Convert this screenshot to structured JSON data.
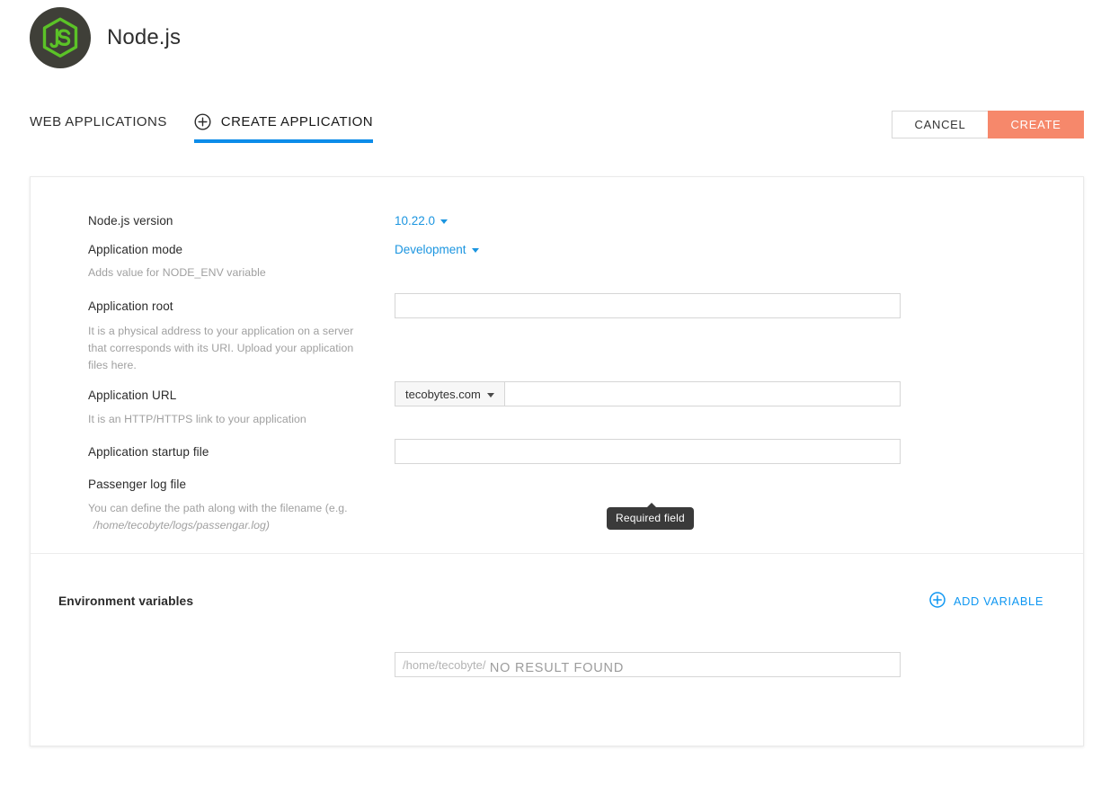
{
  "header": {
    "app_name": "Node.js",
    "logo_icon": "nodejs-logo-icon"
  },
  "tabs": [
    {
      "label": "WEB APPLICATIONS",
      "active": false,
      "icon": null
    },
    {
      "label": "CREATE APPLICATION",
      "active": true,
      "icon": "plus-circle-icon"
    }
  ],
  "actions": {
    "cancel_label": "CANCEL",
    "create_label": "CREATE"
  },
  "form": {
    "node_version": {
      "label": "Node.js version",
      "value": "10.22.0"
    },
    "app_mode": {
      "label": "Application mode",
      "value": "Development",
      "hint": "Adds value for NODE_ENV variable"
    },
    "app_root": {
      "label": "Application root",
      "value": "",
      "placeholder": "",
      "hint": "It is a physical address to your application on a server that corresponds with its URI. Upload your application files here.",
      "tooltip": "Required field"
    },
    "app_url": {
      "label": "Application URL",
      "domain": "tecobytes.com",
      "value": "",
      "placeholder": "",
      "hint": "It is an HTTP/HTTPS link to your application"
    },
    "startup_file": {
      "label": "Application startup file",
      "value": "",
      "placeholder": ""
    },
    "passenger_log": {
      "label": "Passenger log file",
      "value": "",
      "placeholder": "/home/tecobyte/",
      "hint": "You can define the path along with the filename (e.g.",
      "hint_path": "/home/tecobyte/logs/passengar.log)"
    }
  },
  "env_section": {
    "title": "Environment variables",
    "add_label": "ADD VARIABLE",
    "add_icon": "plus-circle-icon",
    "empty_message": "NO RESULT FOUND"
  },
  "colors": {
    "accent_blue": "#0c8ce9",
    "create_button": "#f6886b",
    "logo_green": "#5bc227",
    "logo_circle": "#3f3f38",
    "tooltip_bg": "#3a3a3a"
  }
}
